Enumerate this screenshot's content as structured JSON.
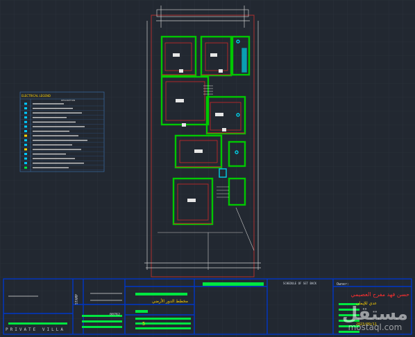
{
  "legend": {
    "title": "ELECTRICAL LEGEND",
    "subtitle": "DESCRIPTION"
  },
  "title_block": {
    "project_label": "PRIVATE VILLA",
    "designer_arabic": "حسن فهد مفرح العصيمي",
    "drawing_title_arabic": "مخطط الدور الأرضي",
    "drawing_number": "5",
    "designed_code": "00762",
    "owner_label": "Owner:",
    "client_short": "عدي للإيمان",
    "date_value": "2023/09/11",
    "schedule_label": "SCHEDULE OF SET BACK",
    "stamp_label": "STAMP"
  },
  "watermark": {
    "arabic": "مستقل",
    "url": "mostaql.com"
  },
  "colors": {
    "background": "#222831",
    "wall": "#00c800",
    "accent_red": "#d22828",
    "cyan": "#00d0e8",
    "white": "#e6e6e6"
  }
}
